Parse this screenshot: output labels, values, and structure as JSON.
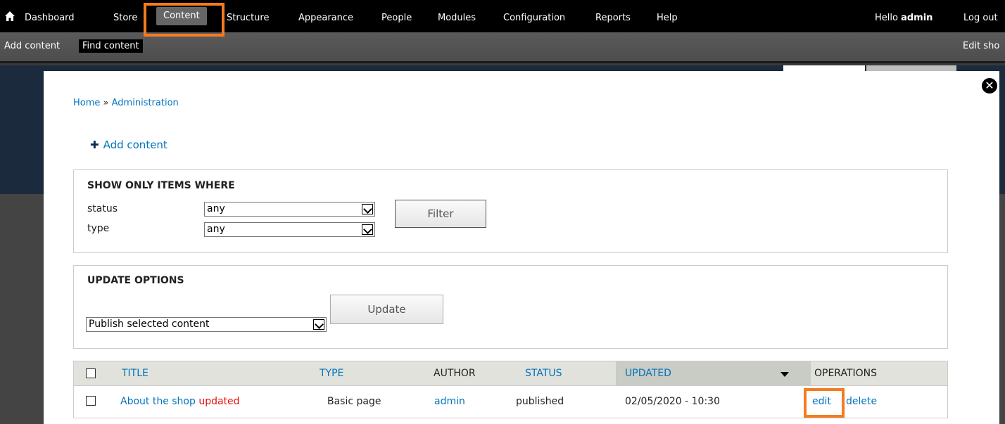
{
  "toolbar": {
    "items": [
      {
        "label": "Dashboard"
      },
      {
        "label": "Store"
      },
      {
        "label": "Content"
      },
      {
        "label": "Structure"
      },
      {
        "label": "Appearance"
      },
      {
        "label": "People"
      },
      {
        "label": "Modules"
      },
      {
        "label": "Configuration"
      },
      {
        "label": "Reports"
      },
      {
        "label": "Help"
      }
    ],
    "hello_prefix": "Hello",
    "username": "admin",
    "logout": "Log out"
  },
  "shortcuts": {
    "add_content": "Add content",
    "find_content": "Find content",
    "edit_shortcuts": "Edit sho"
  },
  "breadcrumb": {
    "home": "Home",
    "separator": "»",
    "admin": "Administration"
  },
  "action_link": {
    "icon": "plus-icon",
    "label": "Add content"
  },
  "filter": {
    "legend": "SHOW ONLY ITEMS WHERE",
    "status_label": "status",
    "status_value": "any",
    "type_label": "type",
    "type_value": "any",
    "button": "Filter"
  },
  "update": {
    "legend": "UPDATE OPTIONS",
    "operation_value": "Publish selected content",
    "button": "Update"
  },
  "table": {
    "headers": {
      "title": "TITLE",
      "type": "TYPE",
      "author": "AUTHOR",
      "status": "STATUS",
      "updated": "UPDATED",
      "operations": "OPERATIONS"
    },
    "rows": [
      {
        "title": "About the shop",
        "marker": "updated",
        "type": "Basic page",
        "author": "admin",
        "status": "published",
        "updated": "02/05/2020 - 10:30",
        "edit": "edit",
        "delete": "delete"
      }
    ]
  },
  "colors": {
    "toolbar": "#000000",
    "link": "#0074bd",
    "highlight": "#f47b20",
    "marker": "#e3100b"
  }
}
